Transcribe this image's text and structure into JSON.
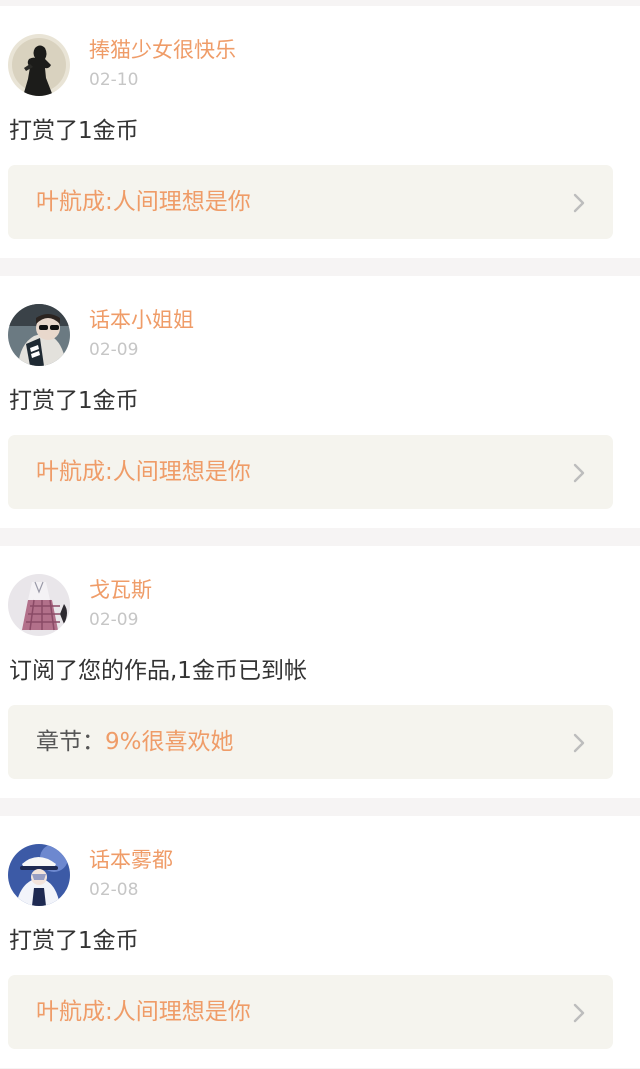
{
  "feed": {
    "items": [
      {
        "username": "捧猫少女很快乐",
        "date": "02-10",
        "message": "打赏了1金币",
        "link": {
          "prefix": "",
          "text": "叶航成:人间理想是你"
        },
        "avatar_icon": "avatar-dark-silhouette"
      },
      {
        "username": "话本小姐姐",
        "date": "02-09",
        "message": "打赏了1金币",
        "link": {
          "prefix": "",
          "text": "叶航成:人间理想是你"
        },
        "avatar_icon": "avatar-sunglasses-portrait"
      },
      {
        "username": "戈瓦斯",
        "date": "02-09",
        "message": "订阅了您的作品,1金币已到帐",
        "link": {
          "prefix": "章节：",
          "text": "9%很喜欢她"
        },
        "avatar_icon": "avatar-plaid-outfit"
      },
      {
        "username": "话本雾都",
        "date": "02-08",
        "message": "打赏了1金币",
        "link": {
          "prefix": "",
          "text": "叶航成:人间理想是你"
        },
        "avatar_icon": "avatar-white-hat-anime"
      }
    ]
  },
  "colors": {
    "username": "#ef9c68",
    "link_text": "#ef9c68",
    "date": "#c6c6c6",
    "message": "#333333",
    "page_background": "#f6f4f4",
    "link_box_background": "#f5f4ee"
  }
}
